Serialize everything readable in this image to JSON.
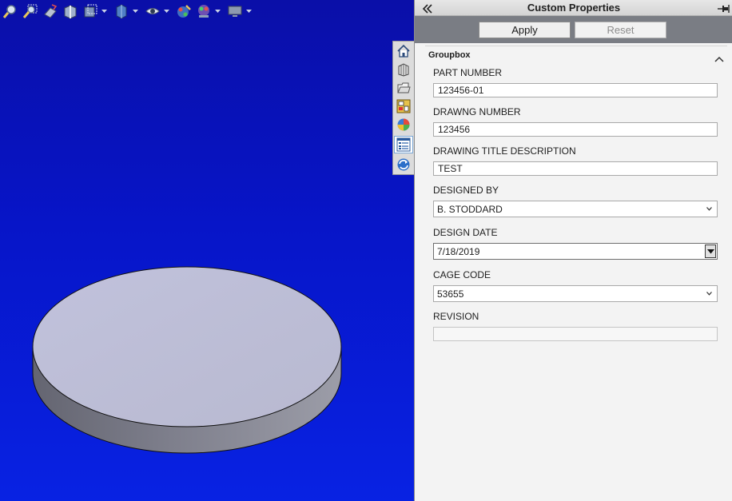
{
  "viewport": {
    "toolbar_icons": [
      "zoom-to-fit-icon",
      "zoom-to-area-icon",
      "previous-view-icon",
      "section-view-icon",
      "view-orientation-icon",
      "display-style-icon",
      "hide-show-items-icon",
      "edit-appearance-icon",
      "apply-scene-icon",
      "view-settings-icon"
    ],
    "background_top": "#0a0fa8",
    "background_bottom": "#0822e3",
    "model_face_color": "#bfc0d8",
    "model_side_color": "#7a7b8a"
  },
  "taskpane_tabs": [
    "home-icon",
    "design-library-icon",
    "file-explorer-icon",
    "view-palette-icon",
    "appearances-icon",
    "custom-properties-icon",
    "solidworks-forum-icon"
  ],
  "panel": {
    "title": "Custom Properties",
    "apply_label": "Apply",
    "reset_label": "Reset",
    "groupbox_title": "Groupbox"
  },
  "fields": {
    "part_number": {
      "label": "PART NUMBER",
      "value": "123456-01"
    },
    "drawing_number": {
      "label": "DRAWNG NUMBER",
      "value": "123456"
    },
    "drawing_title": {
      "label": "DRAWING TITLE DESCRIPTION",
      "value": "TEST"
    },
    "designed_by": {
      "label": "DESIGNED BY",
      "value": "B. STODDARD"
    },
    "design_date": {
      "label": "DESIGN DATE",
      "value": "7/18/2019"
    },
    "cage_code": {
      "label": "CAGE CODE",
      "value": "53655"
    },
    "revision": {
      "label": "REVISION",
      "value": ""
    }
  }
}
